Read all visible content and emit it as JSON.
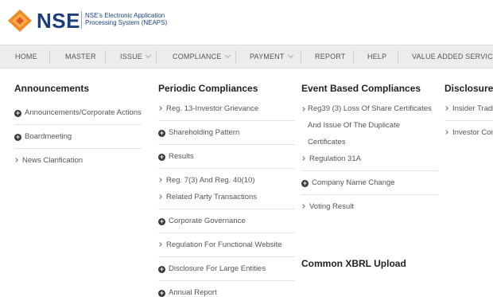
{
  "header": {
    "logo_text": "NSE",
    "tagline": "NSE's Electronic Application Processing System (NEAPS)"
  },
  "nav": {
    "items": [
      {
        "label": "HOME",
        "dropdown": false
      },
      {
        "label": "MASTER",
        "dropdown": false
      },
      {
        "label": "ISSUE",
        "dropdown": true
      },
      {
        "label": "COMPLIANCE",
        "dropdown": true
      },
      {
        "label": "PAYMENT",
        "dropdown": true
      },
      {
        "label": "REPORT",
        "dropdown": false
      },
      {
        "label": "HELP",
        "dropdown": false
      },
      {
        "label": "VALUE ADDED SERVICES",
        "dropdown": false
      }
    ]
  },
  "menu": {
    "announcements": {
      "heading": "Announcements",
      "items": [
        {
          "label": "Announcements/Corporate Actions",
          "icon": "plus-circle-icon"
        },
        {
          "label": "Boardmeeting",
          "icon": "plus-circle-icon"
        },
        {
          "label": "News Clarification",
          "icon": "chevron-right-icon"
        }
      ]
    },
    "periodic": {
      "heading": "Periodic Compliances",
      "items": [
        {
          "label": "Reg. 13-Investor Grievance",
          "icon": "chevron-right-icon"
        },
        {
          "label": "Shareholding Pattern",
          "icon": "plus-circle-icon"
        },
        {
          "label": "Results",
          "icon": "plus-circle-icon"
        },
        {
          "label": "Reg. 7(3) And Reg. 40(10)",
          "icon": "chevron-right-icon"
        },
        {
          "label": "Related Party Transactions",
          "icon": "chevron-right-icon"
        },
        {
          "label": "Corporate Governance",
          "icon": "plus-circle-icon"
        },
        {
          "label": "Regulation For Functional Website",
          "icon": "chevron-right-icon"
        },
        {
          "label": "Disclosure For Large Entities",
          "icon": "plus-circle-icon"
        },
        {
          "label": "Annual Report",
          "icon": "plus-circle-icon"
        }
      ]
    },
    "event": {
      "heading": "Event Based Compliances",
      "items": [
        {
          "label": "Reg39 (3) Loss Of Share Certificates And Issue Of The Duplicate Certificates",
          "icon": "chevron-right-icon"
        },
        {
          "label": "Regulation 31A",
          "icon": "chevron-right-icon"
        },
        {
          "label": "Company Name Change",
          "icon": "plus-circle-icon"
        },
        {
          "label": "Voting Result",
          "icon": "chevron-right-icon"
        }
      ]
    },
    "xbrl": {
      "heading": "Common XBRL Upload"
    },
    "disclosures": {
      "heading": "Disclosures",
      "items": [
        {
          "label": "Insider Trading",
          "icon": "chevron-right-icon"
        },
        {
          "label": "Investor Complaints",
          "icon": "chevron-right-icon"
        }
      ]
    }
  },
  "colors": {
    "brand_blue": "#1b3f7d",
    "logo_orange": "#f08a24",
    "navbar_bg": "#ececec"
  }
}
